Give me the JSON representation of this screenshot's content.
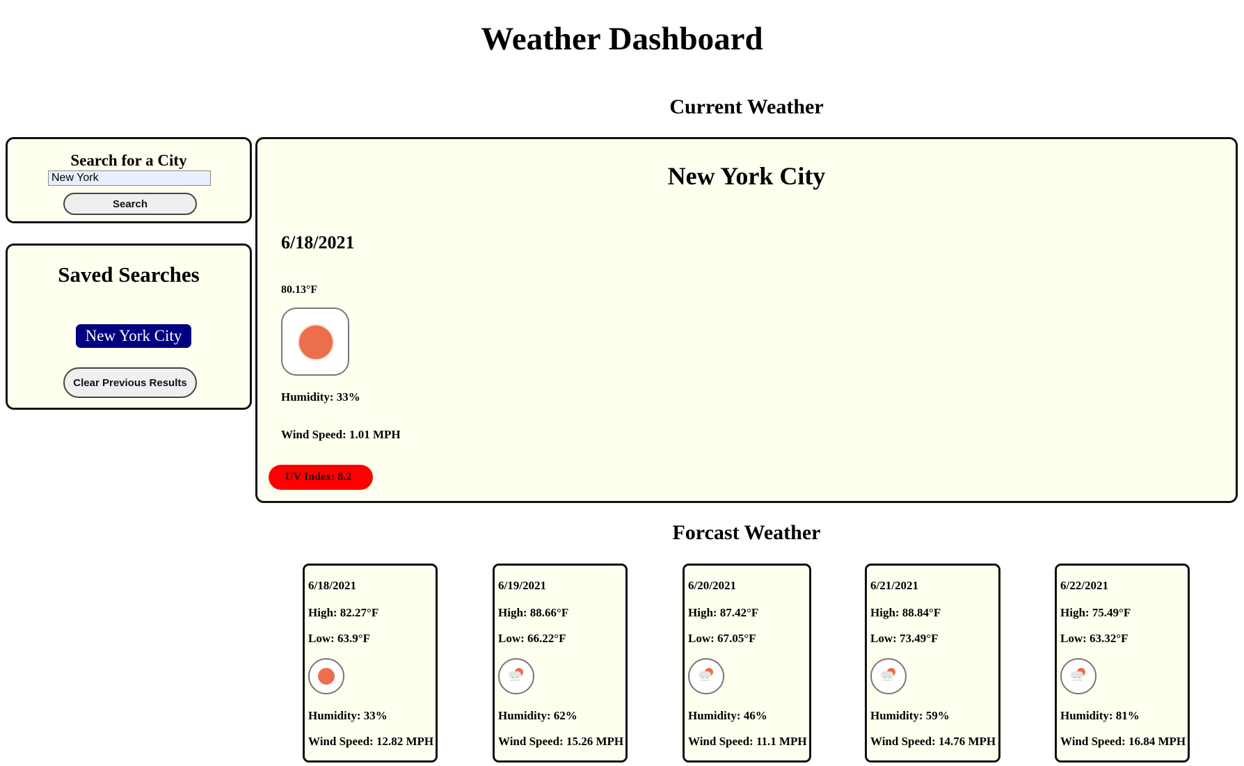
{
  "app": {
    "title": "Weather Dashboard"
  },
  "search": {
    "title": "Search for a City",
    "input_value": "New York",
    "button_label": "Search"
  },
  "saved": {
    "title": "Saved Searches",
    "items": [
      "New York City"
    ],
    "clear_label": "Clear Previous Results"
  },
  "current": {
    "heading": "Current Weather",
    "city": "New York City",
    "date": "6/18/2021",
    "temp": "80.13°F",
    "icon": "sun-icon",
    "humidity": "Humidity: 33%",
    "wind": "Wind Speed: 1.01 MPH",
    "uv": "UV Index: 8.2",
    "uv_color": "#ff0000"
  },
  "forecast": {
    "heading": "Forcast Weather",
    "days": [
      {
        "date": "6/18/2021",
        "high": "High: 82.27°F",
        "low": "Low: 63.9°F",
        "icon": "sun-icon",
        "humidity": "Humidity: 33%",
        "wind": "Wind Speed: 12.82 MPH"
      },
      {
        "date": "6/19/2021",
        "high": "High: 88.66°F",
        "low": "Low: 66.22°F",
        "icon": "rain-icon",
        "humidity": "Humidity: 62%",
        "wind": "Wind Speed: 15.26 MPH"
      },
      {
        "date": "6/20/2021",
        "high": "High: 87.42°F",
        "low": "Low: 67.05°F",
        "icon": "rain-icon",
        "humidity": "Humidity: 46%",
        "wind": "Wind Speed: 11.1 MPH"
      },
      {
        "date": "6/21/2021",
        "high": "High: 88.84°F",
        "low": "Low: 73.49°F",
        "icon": "rain-icon",
        "humidity": "Humidity: 59%",
        "wind": "Wind Speed: 14.76 MPH"
      },
      {
        "date": "6/22/2021",
        "high": "High: 75.49°F",
        "low": "Low: 63.32°F",
        "icon": "rain-icon",
        "humidity": "Humidity: 81%",
        "wind": "Wind Speed: 16.84 MPH"
      }
    ]
  },
  "colors": {
    "panel_bg": "#fffff0",
    "saved_city_bg": "#000080",
    "sun": "#ec6e4c"
  }
}
